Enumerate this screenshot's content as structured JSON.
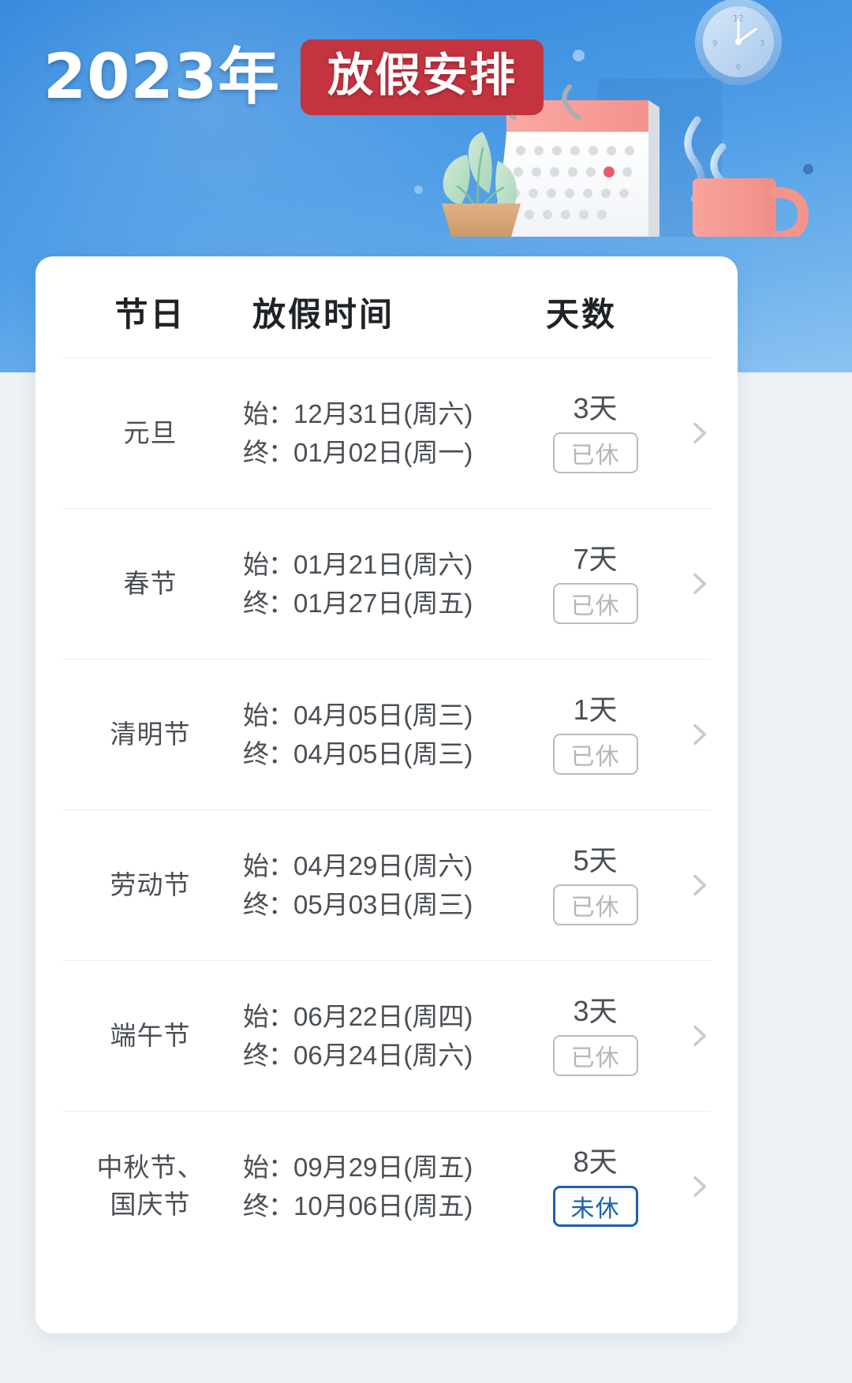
{
  "banner": {
    "year_label": "2023年",
    "tag_label": "放假安排",
    "background_color": "#3d90e0",
    "tag_color": "#c33440",
    "icons": [
      "wall-clock-icon",
      "desk-calendar-icon",
      "potted-plant-icon",
      "coffee-mug-icon"
    ]
  },
  "table": {
    "headers": {
      "holiday": "节日",
      "period": "放假时间",
      "days": "天数"
    },
    "labels": {
      "start": "始：",
      "end": "终："
    },
    "rows": [
      {
        "name": "元旦",
        "start": "12月31日(周六)",
        "end": "01月02日(周一)",
        "days": "3天",
        "status": "已休",
        "status_state": "done"
      },
      {
        "name": "春节",
        "start": "01月21日(周六)",
        "end": "01月27日(周五)",
        "days": "7天",
        "status": "已休",
        "status_state": "done"
      },
      {
        "name": "清明节",
        "start": "04月05日(周三)",
        "end": "04月05日(周三)",
        "days": "1天",
        "status": "已休",
        "status_state": "done"
      },
      {
        "name": "劳动节",
        "start": "04月29日(周六)",
        "end": "05月03日(周三)",
        "days": "5天",
        "status": "已休",
        "status_state": "done"
      },
      {
        "name": "端午节",
        "start": "06月22日(周四)",
        "end": "06月24日(周六)",
        "days": "3天",
        "status": "已休",
        "status_state": "done"
      },
      {
        "name": "中秋节、\n国庆节",
        "start": "09月29日(周五)",
        "end": "10月06日(周五)",
        "days": "8天",
        "status": "未休",
        "status_state": "todo"
      }
    ]
  },
  "colors": {
    "badge_done_border": "#b9bcc0",
    "badge_done_text": "#b4b7bb",
    "badge_todo": "#1a5fb4",
    "text_primary": "#1f2328",
    "text_secondary": "#4a4f55",
    "page_bg": "#eef2f5",
    "card_bg": "#ffffff"
  }
}
